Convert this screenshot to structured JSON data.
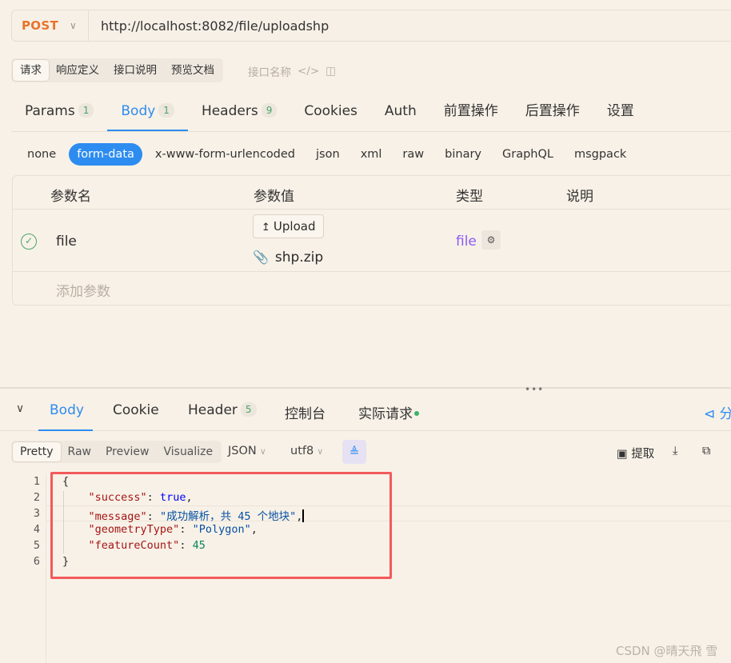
{
  "request": {
    "method": "POST",
    "url": "http://localhost:8082/file/uploadshp"
  },
  "subtabs": [
    "请求",
    "响应定义",
    "接口说明",
    "预览文档"
  ],
  "subtab_extra": "接口名称",
  "request_tabs": [
    {
      "label": "Params",
      "count": "1"
    },
    {
      "label": "Body",
      "count": "1"
    },
    {
      "label": "Headers",
      "count": "9"
    },
    {
      "label": "Cookies",
      "count": ""
    },
    {
      "label": "Auth",
      "count": ""
    },
    {
      "label": "前置操作",
      "count": ""
    },
    {
      "label": "后置操作",
      "count": ""
    },
    {
      "label": "设置",
      "count": ""
    }
  ],
  "body_types": [
    "none",
    "form-data",
    "x-www-form-urlencoded",
    "json",
    "xml",
    "raw",
    "binary",
    "GraphQL",
    "msgpack"
  ],
  "param_table": {
    "headers": [
      "参数名",
      "参数值",
      "类型",
      "说明"
    ],
    "rows": [
      {
        "name": "file",
        "upload_label": "Upload",
        "file_name": "shp.zip",
        "type": "file"
      }
    ],
    "add_placeholder": "添加参数"
  },
  "response_tabs": [
    {
      "label": "Body",
      "count": ""
    },
    {
      "label": "Cookie",
      "count": ""
    },
    {
      "label": "Header",
      "count": "5"
    },
    {
      "label": "控制台",
      "count": ""
    },
    {
      "label": "实际请求",
      "count": ""
    }
  ],
  "share_label": "分",
  "view_modes": [
    "Pretty",
    "Raw",
    "Preview",
    "Visualize"
  ],
  "format_select": "JSON",
  "encoding_select": "utf8",
  "extract_label": "提取",
  "code": {
    "line_numbers": [
      "1",
      "2",
      "3",
      "4",
      "5",
      "6"
    ],
    "open": "{",
    "close": "}",
    "success_key": "\"success\"",
    "success_val": "true",
    "message_key": "\"message\"",
    "message_val": "\"成功解析，共 45 个地块\"",
    "geometry_key": "\"geometryType\"",
    "geometry_val": "\"Polygon\"",
    "count_key": "\"featureCount\"",
    "count_val": "45"
  },
  "watermark": "CSDN @晴天飛 雪",
  "colors": {
    "accent": "#2d8cf0",
    "method": "#e8742a",
    "highlight_box": "#f25a5a"
  }
}
